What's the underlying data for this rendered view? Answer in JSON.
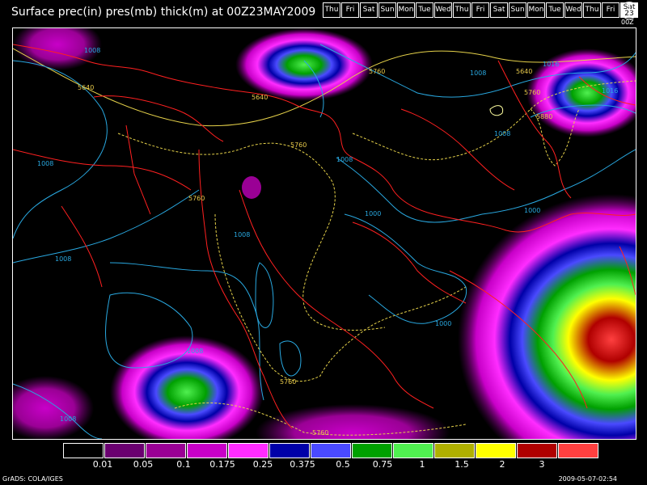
{
  "title": "Surface prec(in) pres(mb) thick(m) at 00Z23MAY2009",
  "days": [
    "Thu",
    "Fri",
    "Sat",
    "Sun",
    "Mon",
    "Tue",
    "Wed",
    "Thu",
    "Fri",
    "Sat",
    "Sun",
    "Mon",
    "Tue",
    "Wed",
    "Thu",
    "Fri"
  ],
  "active_day": {
    "label": "Sat",
    "date": "23"
  },
  "clock_label": "00Z",
  "legend": {
    "colors": [
      "#000000",
      "#6a0070",
      "#9a0095",
      "#c800c8",
      "#ff2cff",
      "#0000a8",
      "#4a4aff",
      "#00a000",
      "#50f050",
      "#b0b000",
      "#ffff00",
      "#b00000",
      "#ff4040"
    ],
    "ticks": [
      "0.01",
      "0.05",
      "0.1",
      "0.175",
      "0.25",
      "0.375",
      "0.5",
      "0.75",
      "1",
      "1.5",
      "2",
      "3"
    ]
  },
  "contour_labels": {
    "pressure": [
      "1008",
      "1008",
      "1016",
      "1008",
      "1008",
      "1008",
      "1008",
      "1016",
      "1000",
      "1000",
      "1008",
      "1000",
      "1008",
      "1008"
    ],
    "thickness": [
      "5640",
      "5640",
      "5760",
      "5640",
      "5760",
      "5880",
      "5760",
      "5760",
      "5760",
      "5760"
    ]
  },
  "footer_left": "GrADS: COLA/IGES",
  "footer_right": "2009-05-07-02:54"
}
